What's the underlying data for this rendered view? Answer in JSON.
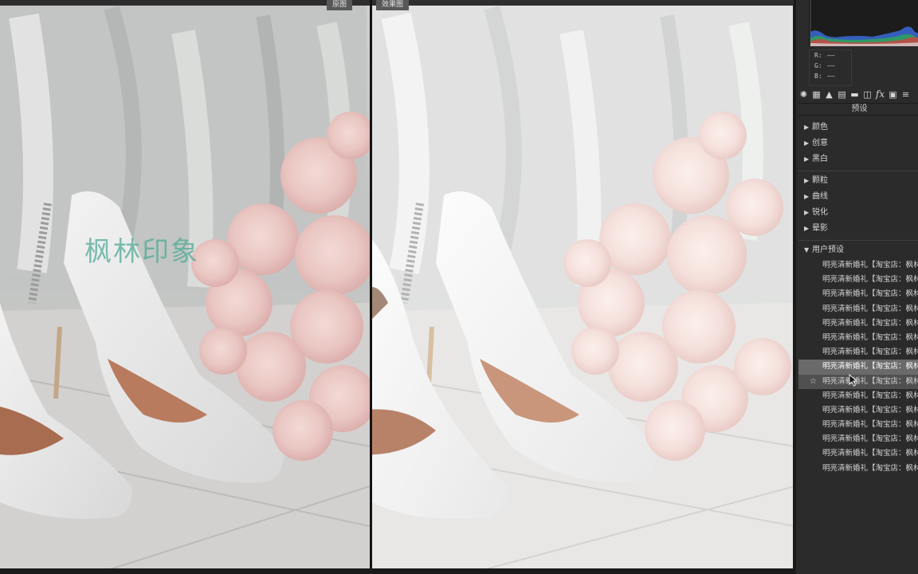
{
  "compare": {
    "before_label": "原图",
    "after_label": "效果图",
    "watermark": "枫林印象"
  },
  "panel": {
    "readout": [
      {
        "channel": "R:",
        "value": "——"
      },
      {
        "channel": "G:",
        "value": "——"
      },
      {
        "channel": "B:",
        "value": "——"
      }
    ],
    "toolbar_icons": [
      "basic-icon",
      "tone-curve-icon",
      "hsl-icon",
      "split-toning-icon",
      "detail-icon",
      "lens-icon",
      "fx-icon",
      "calibration-icon",
      "more-icon"
    ],
    "title": "预设",
    "groups": [
      {
        "label": "颜色"
      },
      {
        "label": "创意"
      },
      {
        "label": "黑白"
      },
      {
        "label": "颗粒"
      },
      {
        "label": "曲线"
      },
      {
        "label": "锐化"
      },
      {
        "label": "晕影"
      }
    ],
    "user_presets_label": "用户预设",
    "presets": [
      "明亮清新婚礼【淘宝店：枫林",
      "明亮清新婚礼【淘宝店：枫林",
      "明亮清新婚礼【淘宝店：枫林",
      "明亮清新婚礼【淘宝店：枫林",
      "明亮清新婚礼【淘宝店：枫林",
      "明亮清新婚礼【淘宝店：枫林",
      "明亮清新婚礼【淘宝店：枫林",
      "明亮清新婚礼【淘宝店：枫林",
      "明亮清新婚礼【淘宝店：枫林",
      "明亮清新婚礼【淘宝店：枫林",
      "明亮清新婚礼【淘宝店：枫林",
      "明亮清新婚礼【淘宝店：枫林",
      "明亮清新婚礼【淘宝店：枫林",
      "明亮清新婚礼【淘宝店：枫林",
      "明亮清新婚礼【淘宝店：枫林"
    ],
    "selected_index": 7,
    "hovered_index": 8
  }
}
